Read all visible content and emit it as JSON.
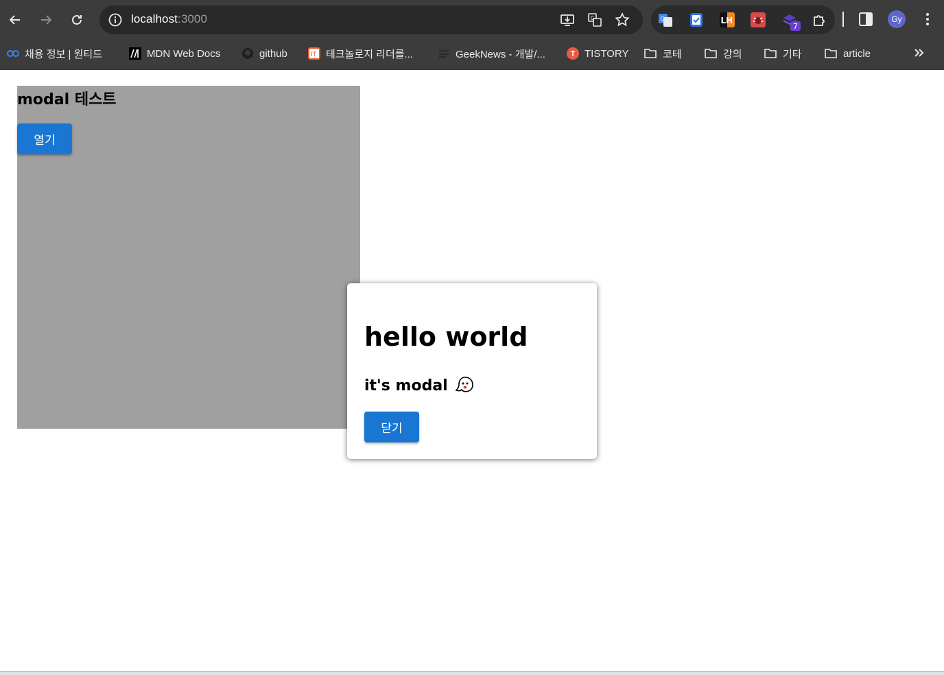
{
  "browser": {
    "url_host": "localhost",
    "url_port": ":3000",
    "profile_initials": "Gy",
    "extension_badge": "7",
    "extension_lh_label": "LH"
  },
  "bookmarks": [
    {
      "label": "채용 정보 | 원티드",
      "icon": "wanted-icon"
    },
    {
      "label": "MDN Web Docs",
      "icon": "mdn-icon"
    },
    {
      "label": "github",
      "icon": "github-icon"
    },
    {
      "label": "테크놀로지 리더를...",
      "icon": "tech-icon"
    },
    {
      "label": "GeekNews - 개발/...",
      "icon": "geeknews-icon"
    },
    {
      "label": "TISTORY",
      "icon": "tistory-icon"
    },
    {
      "label": "코테",
      "icon": "folder-icon"
    },
    {
      "label": "강의",
      "icon": "folder-icon"
    },
    {
      "label": "기타",
      "icon": "folder-icon"
    },
    {
      "label": "article",
      "icon": "folder-icon"
    }
  ],
  "page": {
    "title": "modal 테스트",
    "open_button": "열기"
  },
  "modal": {
    "heading": "hello world",
    "subheading": "it's modal",
    "close_button": "닫기"
  },
  "colors": {
    "button": "#1976d2",
    "container_bg": "#a0a0a0",
    "chrome_bg": "#3c3c3c"
  }
}
